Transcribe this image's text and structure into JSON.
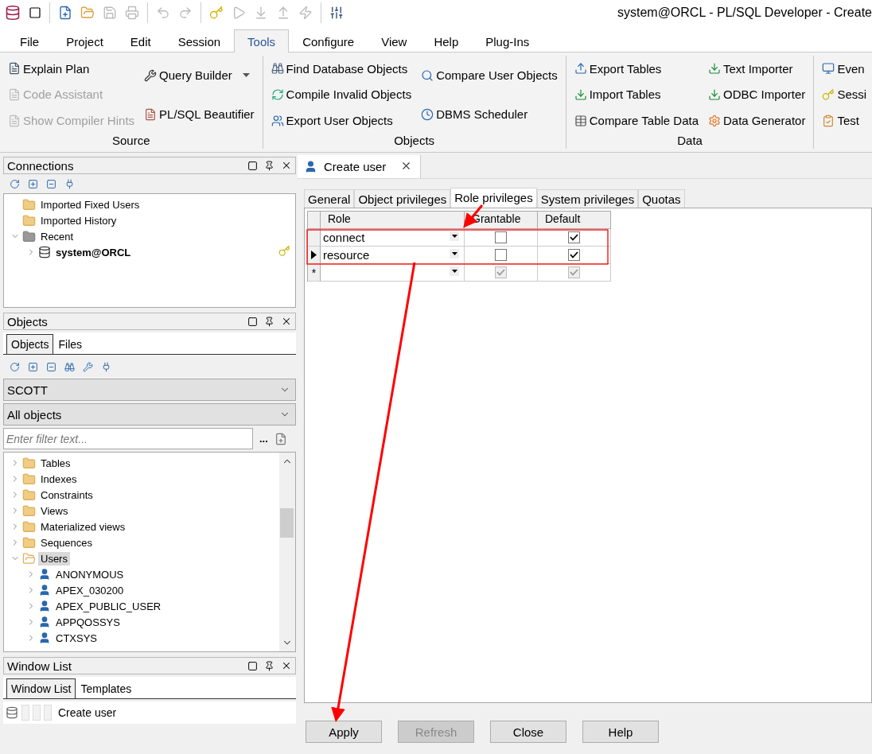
{
  "window": {
    "title": "system@ORCL - PL/SQL Developer - Create"
  },
  "menu": [
    {
      "label": "File",
      "selected": false
    },
    {
      "label": "Project",
      "selected": false
    },
    {
      "label": "Edit",
      "selected": false
    },
    {
      "label": "Session",
      "selected": false
    },
    {
      "label": "Tools",
      "selected": true
    },
    {
      "label": "Configure",
      "selected": false
    },
    {
      "label": "View",
      "selected": false
    },
    {
      "label": "Help",
      "selected": false
    },
    {
      "label": "Plug-Ins",
      "selected": false
    }
  ],
  "ribbon": {
    "groups": [
      {
        "label": "Source",
        "columns": [
          [
            {
              "label": "Explain Plan",
              "disabled": false,
              "dropdown": false
            },
            {
              "label": "Code Assistant",
              "disabled": true,
              "dropdown": false
            },
            {
              "label": "Show Compiler Hints",
              "disabled": true,
              "dropdown": false
            }
          ],
          [
            {
              "label": "Query Builder",
              "disabled": false,
              "dropdown": true
            },
            {
              "label": "PL/SQL Beautifier",
              "disabled": false,
              "dropdown": false
            }
          ]
        ]
      },
      {
        "label": "Objects",
        "columns": [
          [
            {
              "label": "Find Database Objects",
              "disabled": false,
              "dropdown": false
            },
            {
              "label": "Compile Invalid Objects",
              "disabled": false,
              "dropdown": false
            },
            {
              "label": "Export User Objects",
              "disabled": false,
              "dropdown": false
            }
          ],
          [
            {
              "label": "Compare User Objects",
              "disabled": false,
              "dropdown": false
            },
            {
              "label": "DBMS Scheduler",
              "disabled": false,
              "dropdown": false
            }
          ]
        ]
      },
      {
        "label": "Data",
        "columns": [
          [
            {
              "label": "Export Tables",
              "disabled": false,
              "dropdown": false
            },
            {
              "label": "Import Tables",
              "disabled": false,
              "dropdown": false
            },
            {
              "label": "Compare Table Data",
              "disabled": false,
              "dropdown": false
            }
          ],
          [
            {
              "label": "Text Importer",
              "disabled": false,
              "dropdown": false
            },
            {
              "label": "ODBC Importer",
              "disabled": false,
              "dropdown": false
            },
            {
              "label": "Data Generator",
              "disabled": false,
              "dropdown": false
            }
          ]
        ]
      },
      {
        "columns": [
          [
            {
              "label": "Even",
              "disabled": false,
              "dropdown": false
            },
            {
              "label": "Sessi",
              "disabled": false,
              "dropdown": false
            },
            {
              "label": "Test",
              "disabled": false,
              "dropdown": false
            }
          ]
        ]
      }
    ]
  },
  "connections": {
    "title": "Connections",
    "tree": [
      {
        "label": "Imported Fixed Users",
        "kind": "folder",
        "active": false
      },
      {
        "label": "Imported History",
        "kind": "folder",
        "active": false
      },
      {
        "label": "Recent",
        "kind": "folder-grey",
        "active": false,
        "expanded": true,
        "children": [
          {
            "label": "system@ORCL",
            "kind": "connection",
            "active": true,
            "expanded": false
          }
        ]
      }
    ]
  },
  "objects": {
    "title": "Objects",
    "tabs": [
      {
        "label": "Objects",
        "selected": true
      },
      {
        "label": "Files",
        "selected": false
      }
    ],
    "owner": "SCOTT",
    "object_type": "All objects",
    "filter": {
      "placeholder": "Enter filter text..."
    },
    "more_button": "...",
    "tree": [
      {
        "label": "Tables",
        "kind": "folder",
        "selected": false,
        "expanded": false
      },
      {
        "label": "Indexes",
        "kind": "folder",
        "selected": false,
        "expanded": false
      },
      {
        "label": "Constraints",
        "kind": "folder",
        "selected": false,
        "expanded": false
      },
      {
        "label": "Views",
        "kind": "folder",
        "selected": false,
        "expanded": false
      },
      {
        "label": "Materialized views",
        "kind": "folder",
        "selected": false,
        "expanded": false
      },
      {
        "label": "Sequences",
        "kind": "folder",
        "selected": false,
        "expanded": false
      },
      {
        "label": "Users",
        "kind": "folder",
        "selected": true,
        "expanded": true,
        "children": [
          {
            "label": "ANONYMOUS",
            "kind": "user",
            "selected": false,
            "expanded": false
          },
          {
            "label": "APEX_030200",
            "kind": "user",
            "selected": false,
            "expanded": false
          },
          {
            "label": "APEX_PUBLIC_USER",
            "kind": "user",
            "selected": false,
            "expanded": false
          },
          {
            "label": "APPQOSSYS",
            "kind": "user",
            "selected": false,
            "expanded": false
          },
          {
            "label": "CTXSYS",
            "kind": "user",
            "selected": false,
            "expanded": false
          }
        ]
      }
    ]
  },
  "window_list": {
    "title": "Window List",
    "tabs": [
      {
        "label": "Window List",
        "selected": true
      },
      {
        "label": "Templates",
        "selected": false
      }
    ],
    "items": [
      {
        "label": "Create user"
      }
    ]
  },
  "document": {
    "tab": "Create user",
    "subtabs": [
      {
        "label": "General",
        "selected": false
      },
      {
        "label": "Object privileges",
        "selected": false
      },
      {
        "label": "Role privileges",
        "selected": true
      },
      {
        "label": "System privileges",
        "selected": false
      },
      {
        "label": "Quotas",
        "selected": false
      }
    ],
    "grid": {
      "columns": [
        "Role",
        "Grantable",
        "Default"
      ],
      "rows": [
        {
          "kind": "data",
          "current": false,
          "role": "connect",
          "grantable": false,
          "default": true
        },
        {
          "kind": "data",
          "current": true,
          "role": "resource",
          "grantable": false,
          "default": true
        },
        {
          "kind": "new",
          "current": false,
          "marker": "*",
          "grantable": true,
          "default": true
        }
      ]
    },
    "buttons": [
      {
        "label": "Apply",
        "disabled": false
      },
      {
        "label": "Refresh",
        "disabled": true
      },
      {
        "label": "Close",
        "disabled": false
      },
      {
        "label": "Help",
        "disabled": false
      }
    ]
  }
}
